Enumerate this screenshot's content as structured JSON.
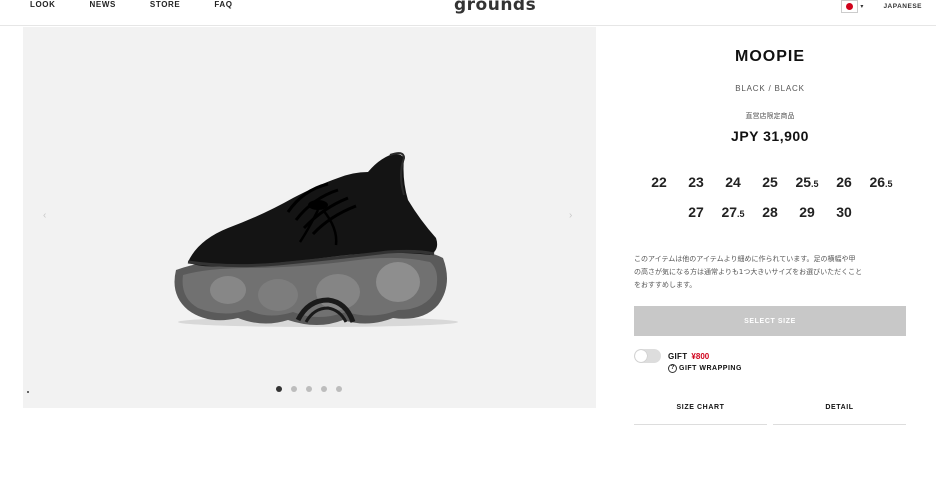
{
  "header": {
    "nav": [
      "LOOK",
      "NEWS",
      "STORE",
      "FAQ"
    ],
    "logo": "grounds",
    "language": "JAPANESE"
  },
  "gallery": {
    "slide_count": 5,
    "active_slide": 1
  },
  "product": {
    "title": "MOOPIE",
    "color": "BLACK / BLACK",
    "limited_note": "直営店限定商品",
    "price": "JPY 31,900",
    "sizes_row1": [
      {
        "main": "22",
        "half": ""
      },
      {
        "main": "23",
        "half": ""
      },
      {
        "main": "24",
        "half": ""
      },
      {
        "main": "25",
        "half": ""
      },
      {
        "main": "25",
        "half": ".5"
      },
      {
        "main": "26",
        "half": ""
      },
      {
        "main": "26",
        "half": ".5"
      }
    ],
    "sizes_row2": [
      {
        "main": "27",
        "half": ""
      },
      {
        "main": "27",
        "half": ".5"
      },
      {
        "main": "28",
        "half": ""
      },
      {
        "main": "29",
        "half": ""
      },
      {
        "main": "30",
        "half": ""
      }
    ],
    "size_note_line1": "このアイテムは他のアイテムより細めに作られています。足の横幅や甲",
    "size_note_line2": "の高さが気になる方は通常よりも1つ大きいサイズをお選びいただくこと",
    "size_note_line3": "をおすすめします。",
    "select_size_label": "SELECT SIZE",
    "gift_label": "GIFT",
    "gift_price": "¥800",
    "gift_wrapping_label": "GIFT WRAPPING",
    "tabs": [
      "SIZE CHART",
      "DETAIL"
    ]
  },
  "colors": {
    "accent_red": "#d0021b",
    "disabled_button": "#c8c8c8"
  }
}
